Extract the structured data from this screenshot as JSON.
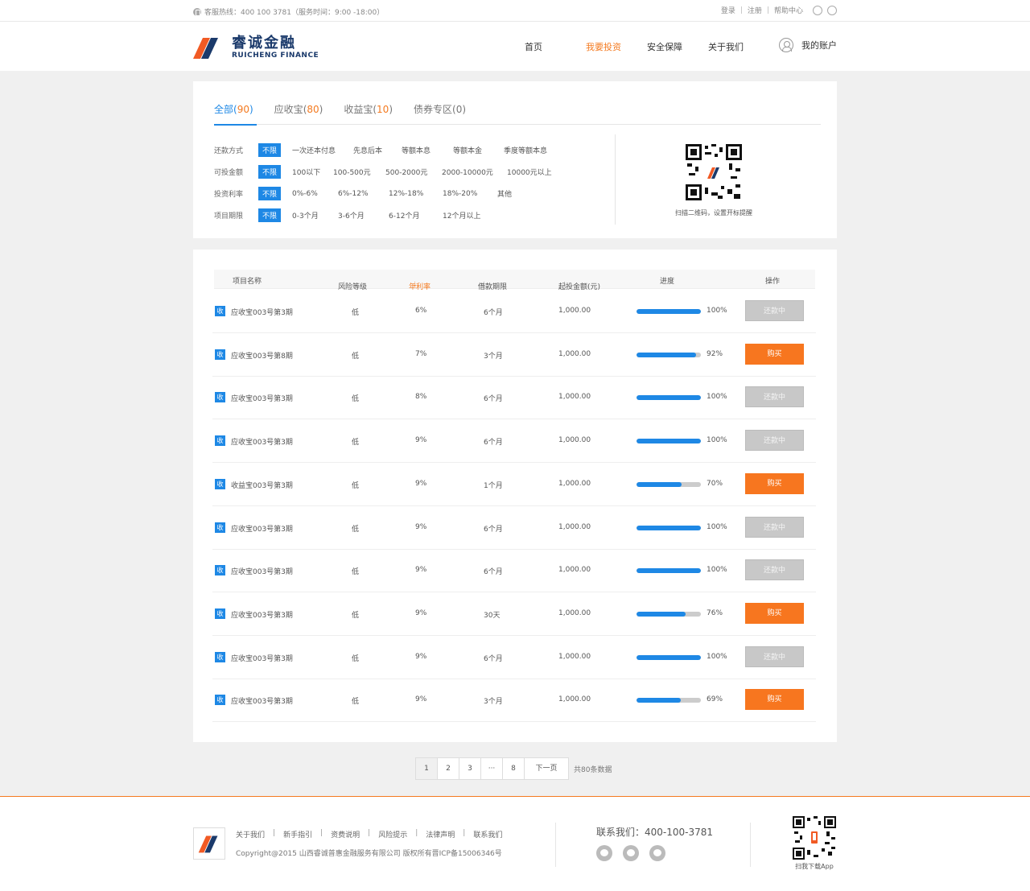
{
  "topbar": {
    "hotline": "客服热线：400 100 3781（服务时间：9:00 -18:00）",
    "login": "登录",
    "register": "注册",
    "help": "帮助中心",
    "sep": "|"
  },
  "header": {
    "logo_cn": "睿诚金融",
    "logo_en": "RUICHENG FINANCE",
    "nav": [
      {
        "label": "首页",
        "active": false
      },
      {
        "label": "我要投资",
        "active": true
      },
      {
        "label": "安全保障",
        "active": false
      },
      {
        "label": "关于我们",
        "active": false
      }
    ],
    "account": "我的账户"
  },
  "filter": {
    "tabs": [
      {
        "label": "全部",
        "count": "90",
        "active": true
      },
      {
        "label": "应收宝",
        "count": "80",
        "active": false
      },
      {
        "label": "收益宝",
        "count": "10",
        "active": false
      },
      {
        "label": "债券专区",
        "count": "0",
        "active": false
      }
    ],
    "rows": [
      {
        "label": "还款方式",
        "selected": "不限",
        "options": [
          "一次还本付息",
          "先息后本",
          "等额本息",
          "等额本金",
          "季度等额本息"
        ]
      },
      {
        "label": "可投金额",
        "selected": "不限",
        "options": [
          "100以下",
          "100-500元",
          "500-2000元",
          "2000-10000元",
          "10000元以上"
        ]
      },
      {
        "label": "投资利率",
        "selected": "不限",
        "options": [
          "0%-6%",
          "6%-12%",
          "12%-18%",
          "18%-20%",
          "其他"
        ]
      },
      {
        "label": "项目期限",
        "selected": "不限",
        "options": [
          "0-3个月",
          "3-6个月",
          "6-12个月",
          "12个月以上"
        ]
      }
    ],
    "qr_caption": "扫描二维码，设置开标提醒"
  },
  "table": {
    "headers": {
      "name": "项目名称",
      "risk": "风险等级",
      "rate": "年利率",
      "term": "借款期限",
      "min": "起投金额(元)",
      "progress": "进度",
      "action": "操作",
      "sort_arrow": "⇣"
    },
    "badge": "收",
    "rows": [
      {
        "name": "应收宝003号第3期",
        "risk": "低",
        "rate": "6%",
        "term": "6个月",
        "min": "1,000.00",
        "progress": 100,
        "progress_label": "100%",
        "action": "还款中",
        "buy": false
      },
      {
        "name": "应收宝003号第8期",
        "risk": "低",
        "rate": "7%",
        "term": "3个月",
        "min": "1,000.00",
        "progress": 92,
        "progress_label": "92%",
        "action": "购买",
        "buy": true
      },
      {
        "name": "应收宝003号第3期",
        "risk": "低",
        "rate": "8%",
        "term": "6个月",
        "min": "1,000.00",
        "progress": 100,
        "progress_label": "100%",
        "action": "还款中",
        "buy": false
      },
      {
        "name": "应收宝003号第3期",
        "risk": "低",
        "rate": "9%",
        "term": "6个月",
        "min": "1,000.00",
        "progress": 100,
        "progress_label": "100%",
        "action": "还款中",
        "buy": false
      },
      {
        "name": "收益宝003号第3期",
        "risk": "低",
        "rate": "9%",
        "term": "1个月",
        "min": "1,000.00",
        "progress": 70,
        "progress_label": "70%",
        "action": "购买",
        "buy": true
      },
      {
        "name": "应收宝003号第3期",
        "risk": "低",
        "rate": "9%",
        "term": "6个月",
        "min": "1,000.00",
        "progress": 100,
        "progress_label": "100%",
        "action": "还款中",
        "buy": false
      },
      {
        "name": "应收宝003号第3期",
        "risk": "低",
        "rate": "9%",
        "term": "6个月",
        "min": "1,000.00",
        "progress": 100,
        "progress_label": "100%",
        "action": "还款中",
        "buy": false
      },
      {
        "name": "应收宝003号第3期",
        "risk": "低",
        "rate": "9%",
        "term": "30天",
        "min": "1,000.00",
        "progress": 76,
        "progress_label": "76%",
        "action": "购买",
        "buy": true
      },
      {
        "name": "应收宝003号第3期",
        "risk": "低",
        "rate": "9%",
        "term": "6个月",
        "min": "1,000.00",
        "progress": 100,
        "progress_label": "100%",
        "action": "还款中",
        "buy": false
      },
      {
        "name": "应收宝003号第3期",
        "risk": "低",
        "rate": "9%",
        "term": "3个月",
        "min": "1,000.00",
        "progress": 69,
        "progress_label": "69%",
        "action": "购买",
        "buy": true
      }
    ]
  },
  "pager": {
    "pages": [
      "1",
      "2",
      "3",
      "···",
      "8"
    ],
    "next": "下一页",
    "total": "共80条数据"
  },
  "footer": {
    "links": [
      "关于我们",
      "新手指引",
      "资费说明",
      "风险提示",
      "法律声明",
      "联系我们"
    ],
    "sep": "|",
    "copyright": "Copyright@2015 山西睿诚普惠金融服务有限公司 版权所有晋ICP备15006346号",
    "contact": "联系我们：400-100-3781",
    "app_caption": "扫我下载App"
  },
  "colors": {
    "accent_blue": "#1e88e5",
    "accent_orange": "#f47a20",
    "brand_navy": "#1b3a6b"
  },
  "icons": [
    "phone-icon",
    "wechat-icon",
    "weibo-icon",
    "user-icon",
    "qq-icon",
    "qr-code-icon"
  ]
}
